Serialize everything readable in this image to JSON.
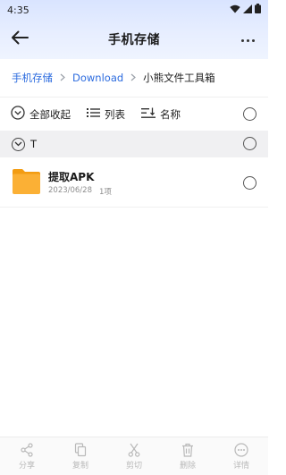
{
  "status_bar": {
    "time": "4:35",
    "icons": [
      "wifi-icon",
      "cellular-icon",
      "battery-icon"
    ]
  },
  "header": {
    "back_icon": "arrow-left-icon",
    "title": "手机存储",
    "more_icon": "more-horizontal-icon"
  },
  "breadcrumb": {
    "items": [
      {
        "label": "手机存储",
        "current": false
      },
      {
        "label": "Download",
        "current": false
      },
      {
        "label": "小熊文件工具箱",
        "current": true
      }
    ],
    "separator_icon": "chevron-right-icon"
  },
  "toolbar": {
    "collapse_all": "全部收起",
    "list_view": "列表",
    "sort_name": "名称"
  },
  "group": {
    "label": "T",
    "expanded": true
  },
  "files": [
    {
      "name": "提取APK",
      "date": "2023/06/28",
      "count": "1项",
      "type": "folder"
    }
  ],
  "bottom_bar": {
    "items": [
      {
        "label": "分享",
        "icon": "share-icon"
      },
      {
        "label": "复制",
        "icon": "copy-icon"
      },
      {
        "label": "剪切",
        "icon": "scissors-icon"
      },
      {
        "label": "删除",
        "icon": "trash-icon"
      },
      {
        "label": "详情",
        "icon": "info-icon"
      }
    ]
  },
  "colors": {
    "accent": "#2d6cdf",
    "folder": "#f6a623",
    "disabled": "#b9b9b9",
    "group_bg": "#f0f0f2"
  }
}
